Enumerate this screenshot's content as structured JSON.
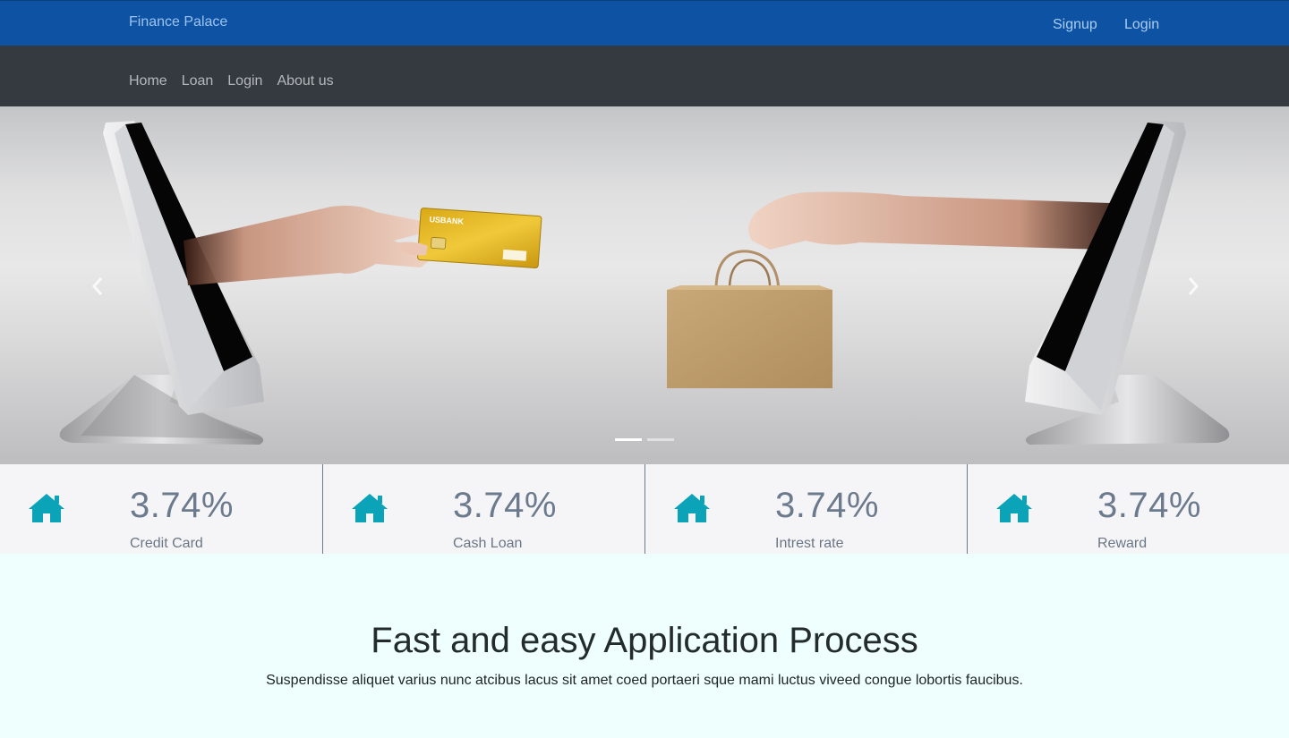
{
  "header": {
    "brand": "Finance Palace",
    "signup": "Signup",
    "login": "Login",
    "color": "#0e52a3"
  },
  "nav": {
    "items": [
      "Home",
      "Loan",
      "Login",
      "About us"
    ],
    "color": "#343a40"
  },
  "carousel": {
    "prev_icon": "chevron-left-icon",
    "next_icon": "chevron-right-icon",
    "slides": 2,
    "active_slide": 1,
    "card_text": "USBANK"
  },
  "stats": [
    {
      "icon": "home-icon",
      "value": "3.74%",
      "label": "Credit Card"
    },
    {
      "icon": "home-icon",
      "value": "3.74%",
      "label": "Cash Loan"
    },
    {
      "icon": "home-icon",
      "value": "3.74%",
      "label": "Intrest rate"
    },
    {
      "icon": "home-icon",
      "value": "3.74%",
      "label": "Reward"
    }
  ],
  "icon_color": "#0aa3b8",
  "section": {
    "title": "Fast and easy Application Process",
    "text": "Suspendisse aliquet varius nunc atcibus lacus sit amet coed portaeri sque mami luctus viveed congue lobortis faucibus."
  }
}
